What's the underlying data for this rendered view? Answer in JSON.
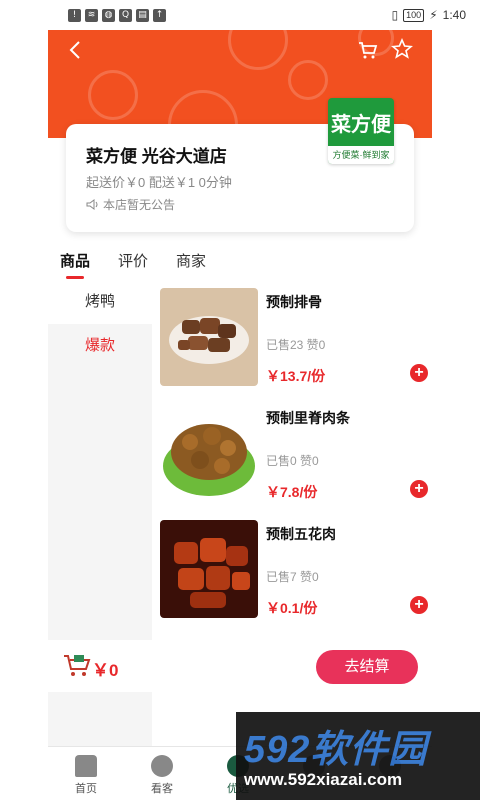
{
  "status_bar": {
    "time": "1:40",
    "battery": "100",
    "left_icons": [
      "!",
      "≋",
      "◍",
      "Q",
      "▤",
      "↑"
    ]
  },
  "header": {
    "back_icon": "chevron-left-icon",
    "cart_icon": "cart-icon",
    "favorite_icon": "star-icon",
    "banner_color": "#f25020"
  },
  "store": {
    "name": "菜方便 光谷大道店",
    "meta": "起送价￥0 配送￥1 0分钟",
    "notice": "本店暂无公告",
    "logo_main": "菜方便",
    "logo_sub": "方便菜·鲜到家"
  },
  "tabs": [
    {
      "label": "商品",
      "active": true
    },
    {
      "label": "评价",
      "active": false
    },
    {
      "label": "商家",
      "active": false
    }
  ],
  "categories": [
    {
      "label": "烤鸭",
      "active": true
    },
    {
      "label": "爆款",
      "active": false
    }
  ],
  "products": [
    {
      "name": "预制排骨",
      "sales": "已售23 赞0",
      "price": "￥13.7/份"
    },
    {
      "name": "预制里脊肉条",
      "sales": "已售0 赞0",
      "price": "￥7.8/份"
    },
    {
      "name": "预制五花肉",
      "sales": "已售7 赞0",
      "price": "￥0.1/份"
    }
  ],
  "cart": {
    "total": "￥0",
    "checkout_label": "去结算"
  },
  "bottom_nav": [
    {
      "label": "首页",
      "icon": "home-icon"
    },
    {
      "label": "看客",
      "icon": "play-icon"
    },
    {
      "label": "优选",
      "icon": "check-icon"
    },
    {
      "label": "",
      "icon": "list-icon"
    },
    {
      "label": "",
      "icon": "user-icon"
    }
  ],
  "watermark": {
    "main": "592软件园",
    "url": "www.592xiazai.com"
  },
  "colors": {
    "accent": "#e8282b",
    "checkout": "#e8325a",
    "brand_green": "#1f9a3c"
  }
}
